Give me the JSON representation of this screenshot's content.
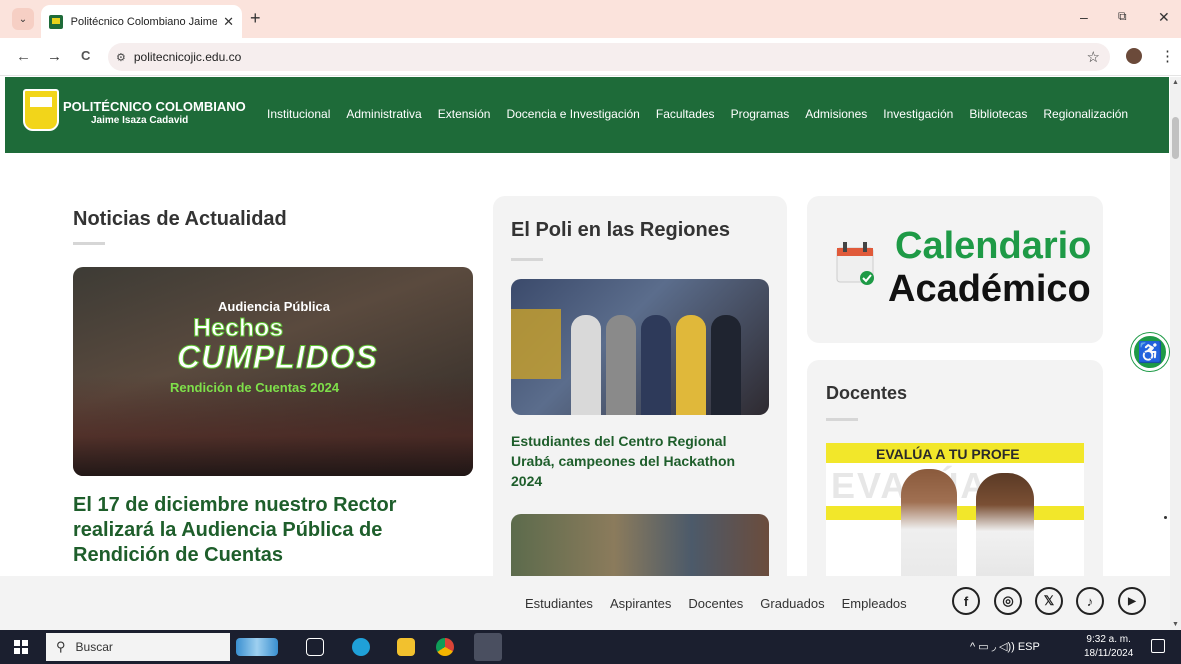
{
  "browser": {
    "tab_title": "Politécnico Colombiano Jaime I",
    "tab_close": "✕",
    "new_tab": "+",
    "url": "politecnicojic.edu.co",
    "back": "←",
    "forward": "→",
    "reload": "C",
    "site_info": "⚙",
    "bookmark": "☆",
    "menu": "⋮",
    "minimize": "–",
    "restore": "⧉",
    "close": "✕",
    "tab_list": "⌄"
  },
  "header": {
    "brand_name": "POLITÉCNICO COLOMBIANO",
    "brand_sub": "Jaime Isaza Cadavid",
    "nav": [
      "Institucional",
      "Administrativa",
      "Extensión",
      "Docencia e Investigación",
      "Facultades",
      "Programas",
      "Admisiones",
      "Investigación",
      "Bibliotecas",
      "Regionalización"
    ]
  },
  "news": {
    "section_title": "Noticias de Actualidad",
    "image_overlay": {
      "line1": "Audiencia Pública",
      "line2": "Hechos",
      "line3": "CUMPLIDOS",
      "line4": "Rendición de Cuentas 2024"
    },
    "headline": "El 17 de diciembre nuestro Rector realizará la Audiencia Pública de Rendición de Cuentas"
  },
  "regions": {
    "section_title": "El Poli en las Regiones",
    "caption": "Estudiantes del Centro Regional Urabá, campeones del Hackathon 2024"
  },
  "calendar": {
    "line1": "Calendario",
    "line2": "Académico"
  },
  "teachers": {
    "section_title": "Docentes",
    "banner_text": "EVALÚA A TU PROFE",
    "banner_ghost": "EVALÚA A"
  },
  "footer": {
    "links": [
      "Estudiantes",
      "Aspirantes",
      "Docentes",
      "Graduados",
      "Empleados"
    ],
    "social": [
      "f",
      "◎",
      "𝕏",
      "♪",
      "▶"
    ]
  },
  "taskbar": {
    "search_placeholder": "Buscar",
    "tray": "^  ▭  ◞  ◁))  ESP",
    "time": "9:32 a. m.",
    "date": "18/11/2024"
  },
  "colors": {
    "brand_green": "#1e6b39",
    "accent_green": "#1e9a46",
    "headline_green": "#1e5e2b",
    "yellow": "#f2e72a"
  }
}
